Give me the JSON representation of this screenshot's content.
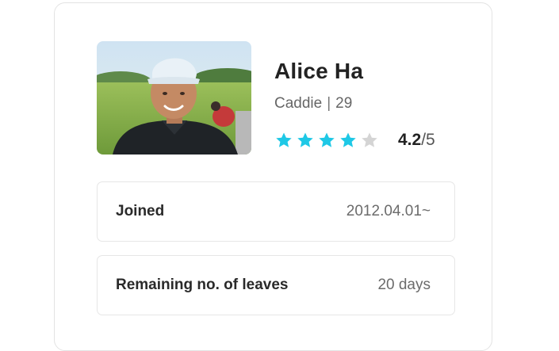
{
  "profile": {
    "name": "Alice Ha",
    "role": "Caddie",
    "separator": "|",
    "age": "29",
    "rating": {
      "value": "4.2",
      "max": "/5",
      "filled_stars": 4,
      "total_stars": 5
    }
  },
  "details": [
    {
      "label": "Joined",
      "value": "2012.04.01~"
    },
    {
      "label": "Remaining no. of leaves",
      "value": "20 days"
    }
  ],
  "colors": {
    "star_filled": "#1ec8e6",
    "star_empty": "#d4d4d4",
    "card_border": "#e3e3e3"
  },
  "icons": {
    "rating_star": "star-icon"
  }
}
